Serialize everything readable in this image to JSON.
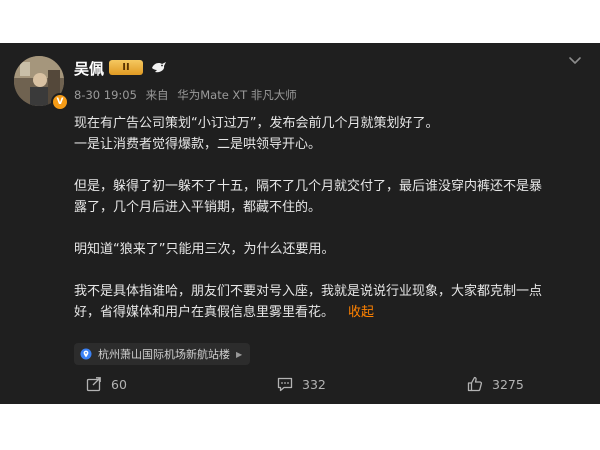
{
  "post": {
    "author": {
      "name": "吴佩",
      "vip_badge": "II",
      "verify_badge": "V"
    },
    "meta": {
      "time": "8-30 19:05",
      "source_prefix": "来自",
      "device": "华为Mate XT 非凡大师"
    },
    "content": {
      "p1_l1": "现在有广告公司策划“小订过万”，发布会前几个月就策划好了。",
      "p1_l2": "一是让消费者觉得爆款，二是哄领导开心。",
      "p2_l1": "但是，躲得了初一躲不了十五，隔不了几个月就交付了，最后谁没穿内裤还不是暴",
      "p2_l2": "露了，几个月后进入平销期，都藏不住的。",
      "p3": "明知道“狼来了”只能用三次，为什么还要用。",
      "p4_l1": "我不是具体指谁哈，朋友们不要对号入座，我就是说说行业现象，大家都克制一点",
      "p4_l2": "好，省得媒体和用户在真假信息里雾里看花。",
      "collapse_label": "收起"
    },
    "location": "杭州萧山国际机场新航站楼",
    "actions": {
      "repost_count": "60",
      "comment_count": "332",
      "like_count": "3275"
    },
    "colors": {
      "card_bg": "#1f1f1f",
      "accent_orange": "#ff8200",
      "text_primary": "#e6e6e6",
      "text_secondary": "#9a9a9a"
    }
  }
}
